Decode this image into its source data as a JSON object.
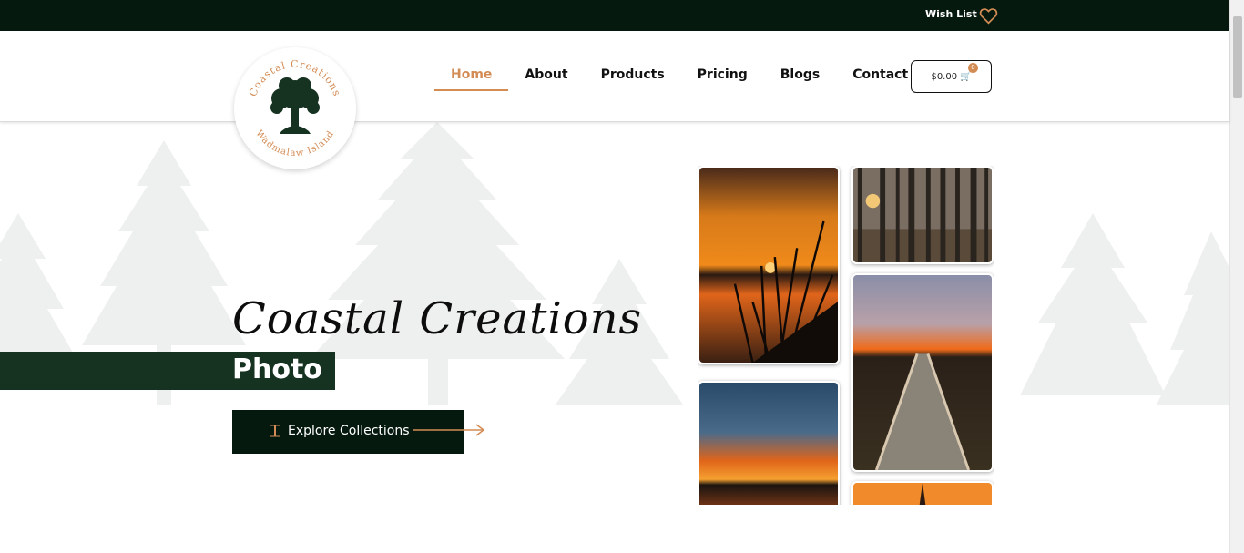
{
  "topbar": {
    "wish_list": "Wish List"
  },
  "nav": {
    "items": [
      {
        "label": "Home",
        "active": true
      },
      {
        "label": "About",
        "active": false
      },
      {
        "label": "Products",
        "active": false
      },
      {
        "label": "Pricing",
        "active": false
      },
      {
        "label": "Blogs",
        "active": false
      },
      {
        "label": "Contact",
        "active": false
      }
    ]
  },
  "cart": {
    "total": "$0.00",
    "count": "0"
  },
  "logo": {
    "top_text": "Coastal Creations",
    "bottom_text": "Wadmalaw Island"
  },
  "hero": {
    "title": "Coastal Creations",
    "subtitle": "Photo",
    "cta": "Explore Collections"
  },
  "colors": {
    "dark_green": "#05190f",
    "band_green": "#163221",
    "accent": "#d48c55"
  },
  "icons": [
    "heart-icon",
    "cart-icon",
    "book-icon",
    "arrow-right-icon"
  ]
}
